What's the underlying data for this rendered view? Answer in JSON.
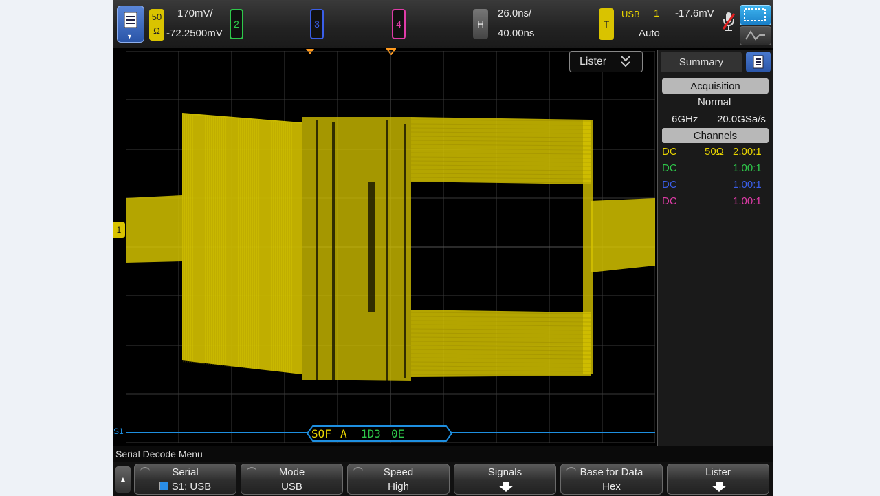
{
  "topbar": {
    "ch1_box_line1": "50",
    "ch1_box_line2": "Ω",
    "ch1_scale": "170mV/",
    "ch1_offset": "-72.2500mV",
    "ch2_label": "2",
    "ch3_label": "3",
    "ch4_label": "4",
    "h_label": "H",
    "time_scale": "26.0ns/",
    "time_delay": "40.00ns",
    "trig_label": "T",
    "trig_type": "USB",
    "trig_source": "1",
    "trig_level": "-17.6mV",
    "trig_mode": "Auto"
  },
  "waveform": {
    "lister_button": "Lister",
    "ch1_marker": "1",
    "serial_marker": "S1",
    "decode_segments": {
      "sof": "SOF",
      "a": "A",
      "addr": "1D3",
      "crc": "0E"
    }
  },
  "panel": {
    "tab_label": "Summary",
    "acquisition_header": "Acquisition",
    "acq_mode": "Normal",
    "bandwidth": "6GHz",
    "sample_rate": "20.0GSa/s",
    "channels_header": "Channels",
    "channels": [
      {
        "coupling": "DC",
        "impedance": "50Ω",
        "probe": "2.00:1",
        "color": "#e8d400"
      },
      {
        "coupling": "DC",
        "impedance": "",
        "probe": "1.00:1",
        "color": "#2ec84a"
      },
      {
        "coupling": "DC",
        "impedance": "",
        "probe": "1.00:1",
        "color": "#3a5ee8"
      },
      {
        "coupling": "DC",
        "impedance": "",
        "probe": "1.00:1",
        "color": "#e03ca8"
      }
    ]
  },
  "menu": {
    "title": "Serial Decode Menu",
    "softkeys": [
      {
        "label": "Serial",
        "value": "S1: USB"
      },
      {
        "label": "Mode",
        "value": "USB"
      },
      {
        "label": "Speed",
        "value": "High"
      },
      {
        "label": "Signals",
        "value": ""
      },
      {
        "label": "Base for Data",
        "value": "Hex"
      },
      {
        "label": "Lister",
        "value": ""
      }
    ]
  },
  "colors": {
    "ch1": "#d4c200",
    "ch2": "#2ec84a",
    "ch3": "#3a5ee8",
    "ch4": "#e03ca8",
    "serial_bus": "#1e8fe0",
    "trigger_marker": "#ff9a1e"
  },
  "icons": [
    "menu-icon",
    "microphone-icon",
    "capture-icon",
    "waveform-icon",
    "chevron-down-icon",
    "arrow-down-icon",
    "arrow-up-icon"
  ]
}
